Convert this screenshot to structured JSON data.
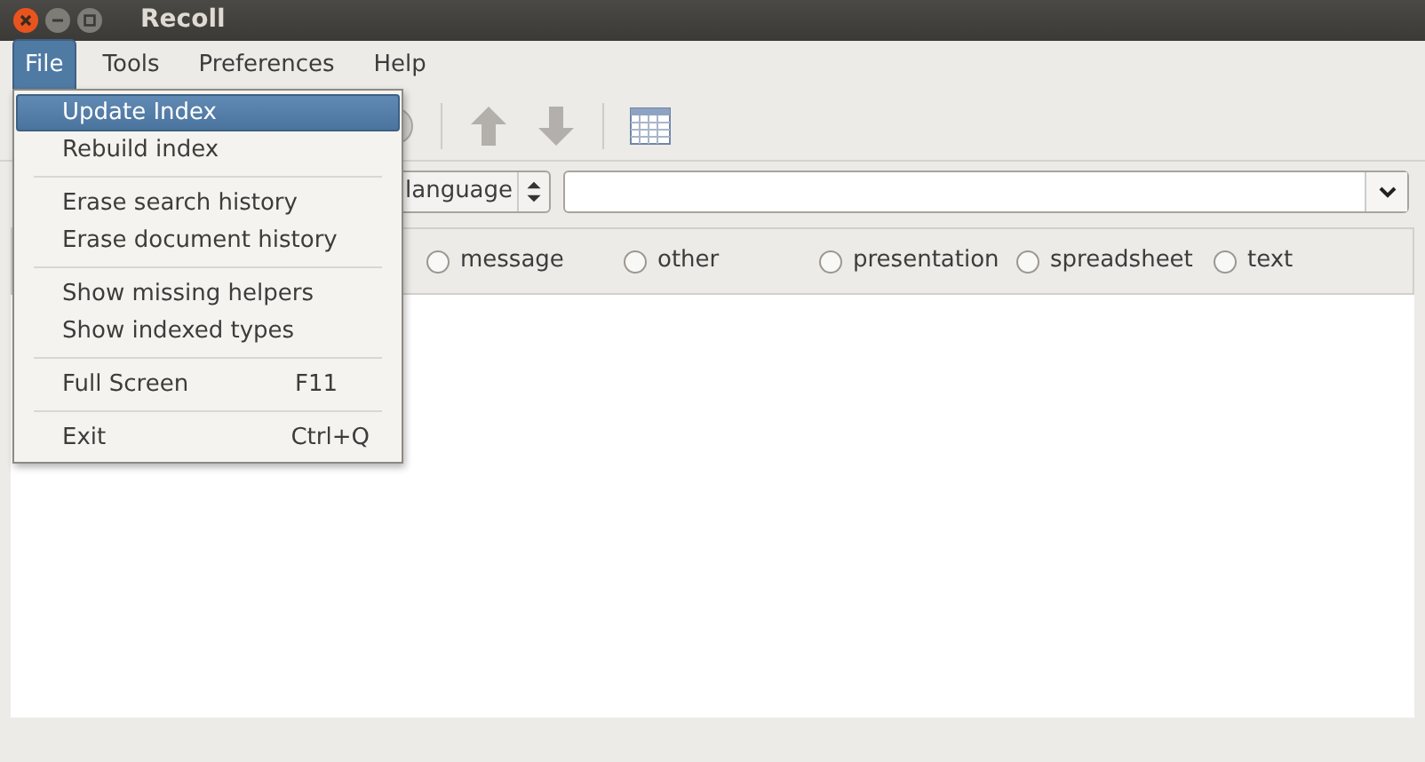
{
  "window": {
    "title": "Recoll"
  },
  "menubar": [
    {
      "label": "File",
      "selected": true
    },
    {
      "label": "Tools",
      "selected": false
    },
    {
      "label": "Preferences",
      "selected": false
    },
    {
      "label": "Help",
      "selected": false
    }
  ],
  "file_menu": [
    {
      "kind": "item",
      "label": "Update Index",
      "selected": true
    },
    {
      "kind": "item",
      "label": "Rebuild index",
      "selected": false
    },
    {
      "kind": "separator"
    },
    {
      "kind": "item",
      "label": "Erase search history",
      "selected": false
    },
    {
      "kind": "item",
      "label": "Erase document history",
      "selected": false
    },
    {
      "kind": "separator"
    },
    {
      "kind": "item",
      "label": "Show missing helpers",
      "selected": false
    },
    {
      "kind": "item",
      "label": "Show indexed types",
      "selected": false
    },
    {
      "kind": "separator"
    },
    {
      "kind": "item",
      "label": "Full Screen",
      "shortcut": "F11",
      "selected": false
    },
    {
      "kind": "separator"
    },
    {
      "kind": "item",
      "label": "Exit",
      "shortcut": "Ctrl+Q",
      "selected": false
    }
  ],
  "search": {
    "mode": "language"
  },
  "categories": [
    {
      "label": "message",
      "selected": false
    },
    {
      "label": "other",
      "selected": false
    },
    {
      "label": "presentation",
      "selected": false
    },
    {
      "label": "spreadsheet",
      "selected": false
    },
    {
      "label": "text",
      "selected": false
    }
  ]
}
